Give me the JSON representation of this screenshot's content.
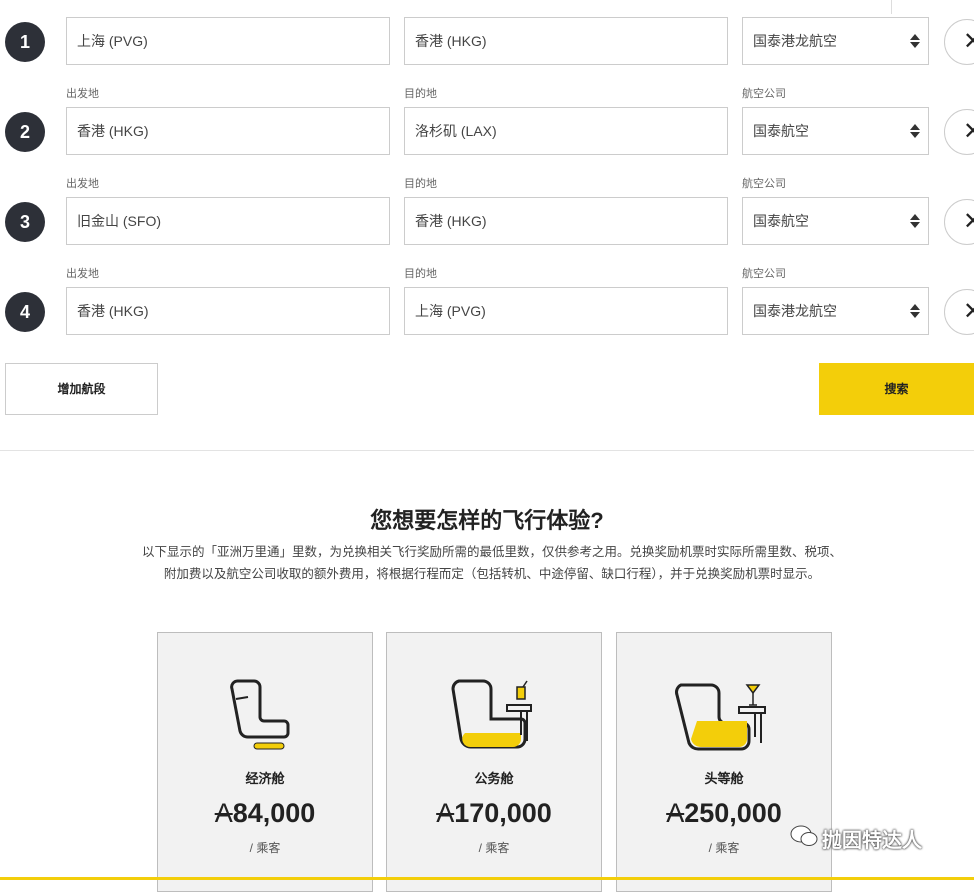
{
  "legs": [
    {
      "number": "1",
      "origin": "上海 (PVG)",
      "destination": "香港 (HKG)",
      "airline": "国泰港龙航空"
    },
    {
      "number": "2",
      "origin": "香港 (HKG)",
      "destination": "洛杉矶 (LAX)",
      "airline": "国泰航空"
    },
    {
      "number": "3",
      "origin": "旧金山 (SFO)",
      "destination": "香港 (HKG)",
      "airline": "国泰航空"
    },
    {
      "number": "4",
      "origin": "香港 (HKG)",
      "destination": "上海 (PVG)",
      "airline": "国泰港龙航空"
    }
  ],
  "labels": {
    "origin": "出发地",
    "destination": "目的地",
    "airline": "航空公司"
  },
  "buttons": {
    "add_leg": "增加航段",
    "search": "搜索",
    "remove_symbol": "✕"
  },
  "experience": {
    "title": "您想要怎样的飞行体验?",
    "description_line1": "以下显示的「亚洲万里通」里数，为兑换相关飞行奖励所需的最低里数，仅供参考之用。兑换奖励机票时实际所需里数、税项、",
    "description_line2": "附加费以及航空公司收取的额外费用，将根据行程而定（包括转机、中途停留、缺口行程），并于兑换奖励机票时显示。"
  },
  "cabins": [
    {
      "name": "经济舱",
      "miles": "84,000",
      "unit": "/ 乘客",
      "icon": "economy-seat-icon"
    },
    {
      "name": "公务舱",
      "miles": "170,000",
      "unit": "/ 乘客",
      "icon": "business-seat-icon"
    },
    {
      "name": "头等舱",
      "miles": "250,000",
      "unit": "/ 乘客",
      "icon": "first-seat-icon"
    }
  ],
  "currency_symbol": "A",
  "watermark": "抛因特达人",
  "colors": {
    "accent": "#f3ce0a",
    "badge": "#2d3038"
  }
}
